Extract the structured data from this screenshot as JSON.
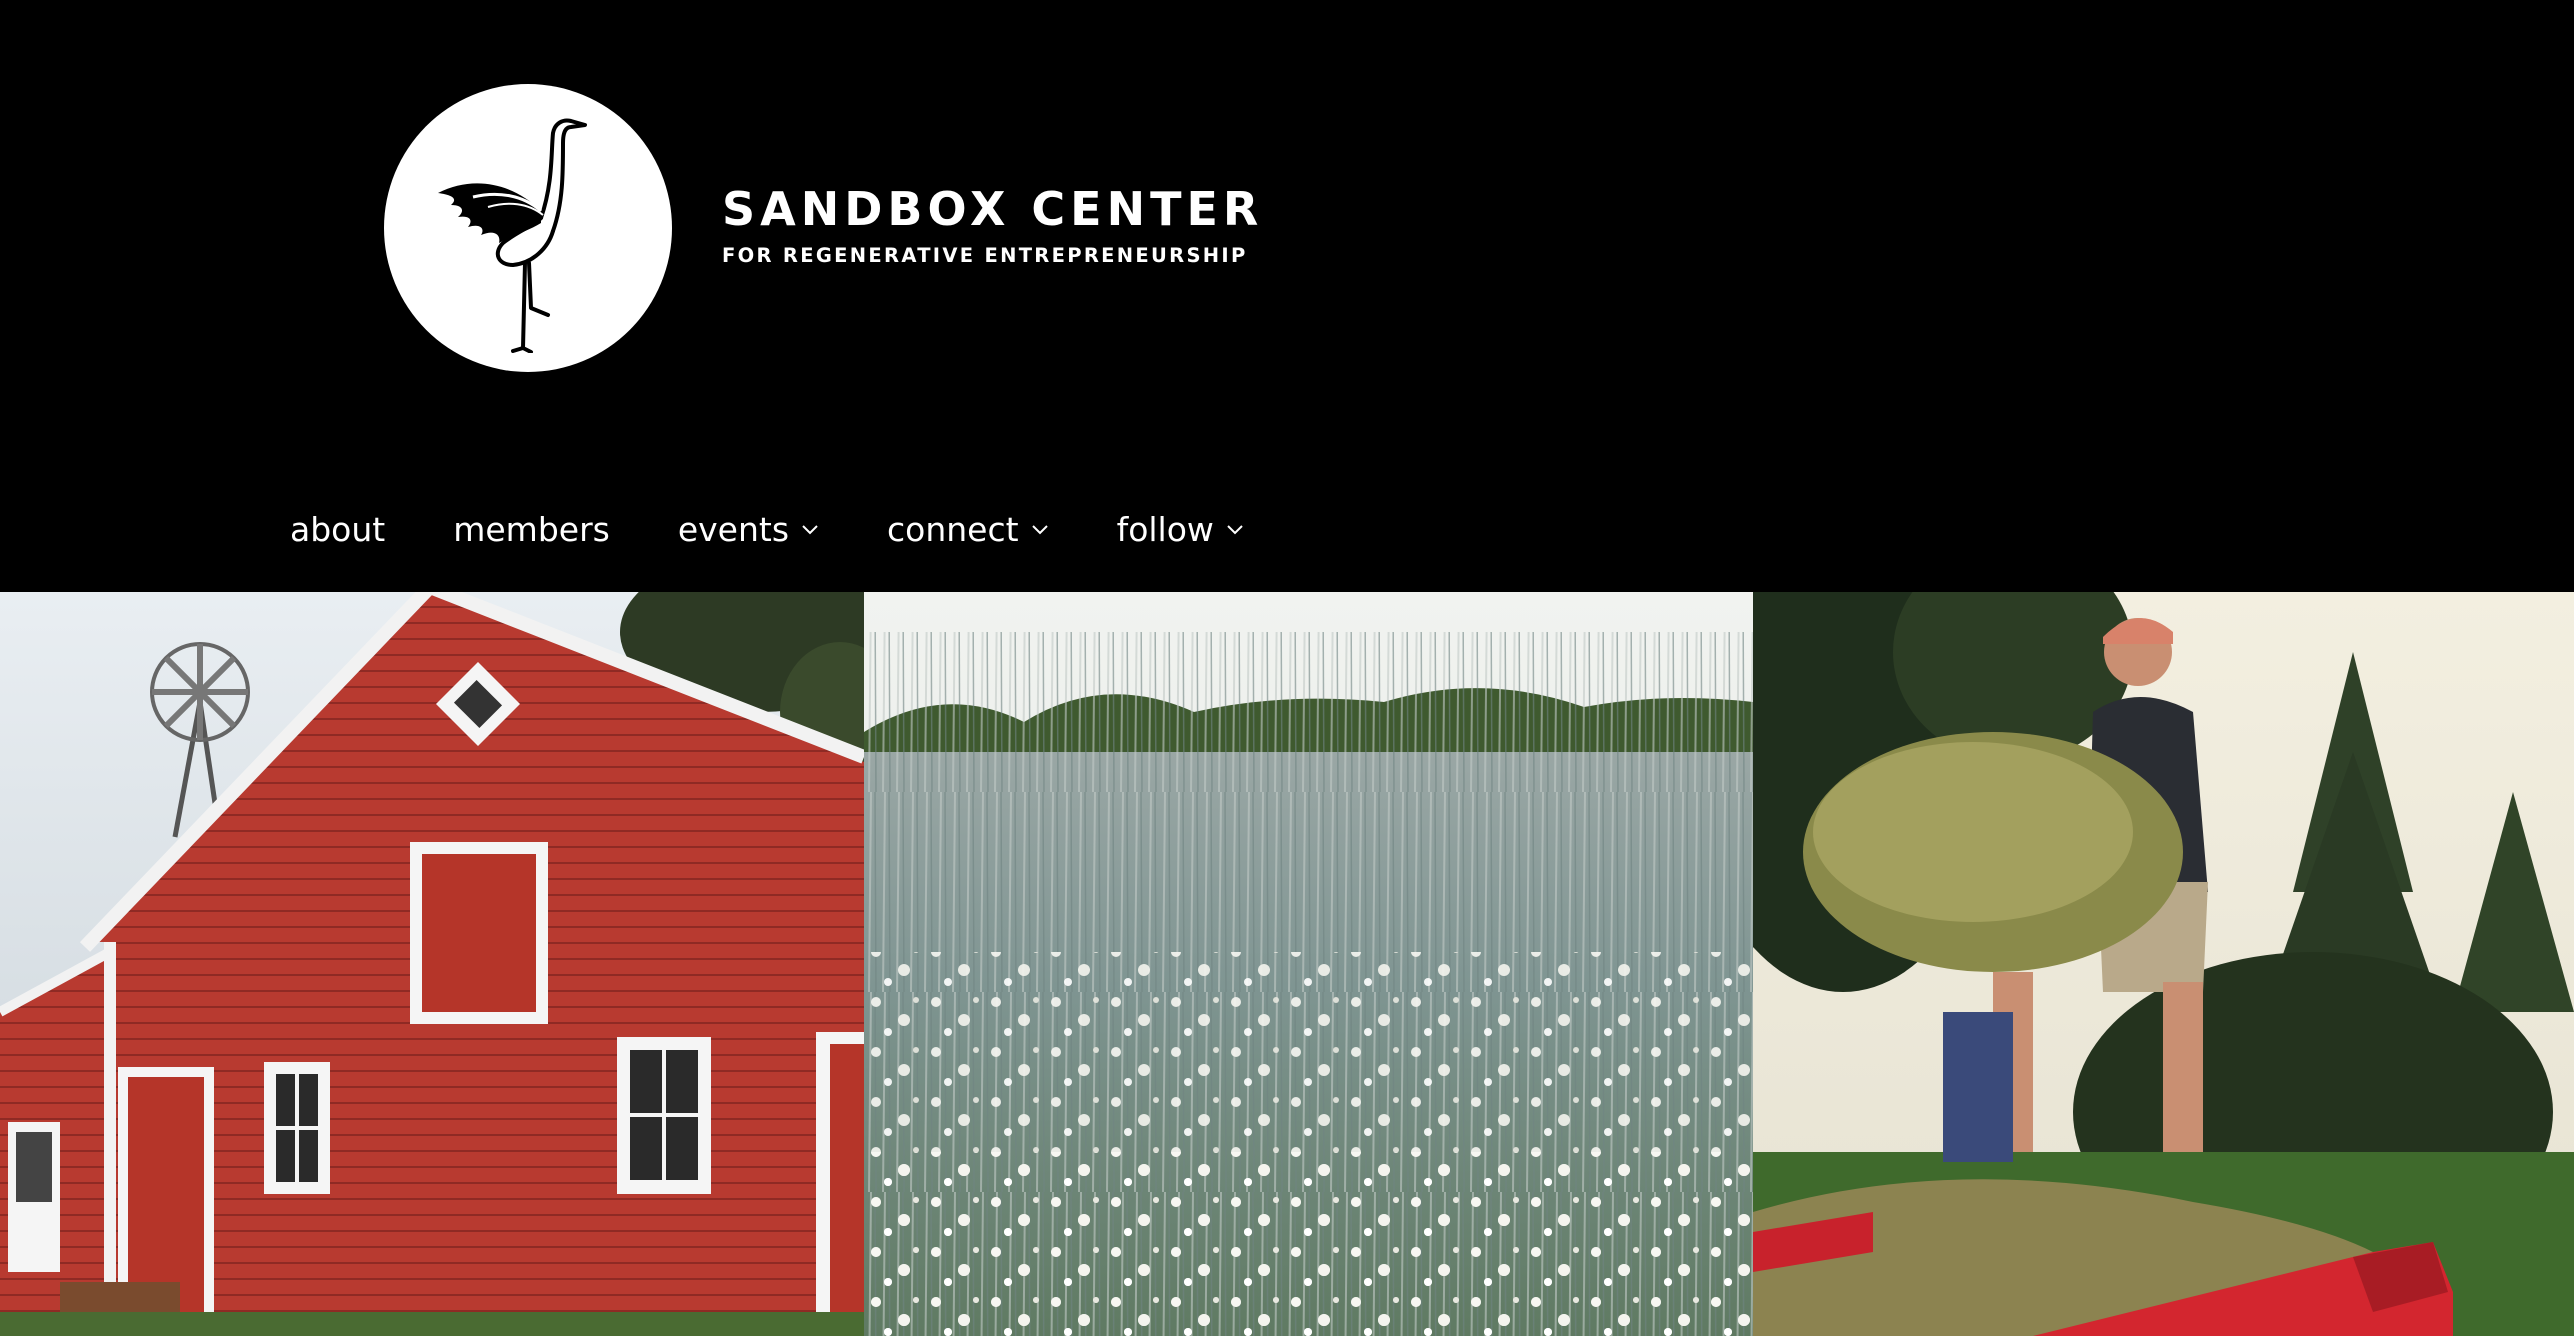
{
  "header": {
    "logo_icon": "crane-icon",
    "brand_name": "SANDBOX CENTER",
    "brand_tagline": "FOR REGENERATIVE ENTREPRENEURSHIP"
  },
  "nav": {
    "items": [
      {
        "label": "about",
        "has_dropdown": false
      },
      {
        "label": "members",
        "has_dropdown": false
      },
      {
        "label": "events",
        "has_dropdown": true
      },
      {
        "label": "connect",
        "has_dropdown": true
      },
      {
        "label": "follow",
        "has_dropdown": true
      }
    ],
    "dropdown_icon": "chevron-down-icon"
  },
  "photos": [
    {
      "subject": "red-barn-photo"
    },
    {
      "subject": "grain-field-photo"
    },
    {
      "subject": "hay-unloading-photo"
    }
  ],
  "colors": {
    "background": "#000000",
    "text": "#ffffff",
    "barn_red": "#b83a30"
  }
}
